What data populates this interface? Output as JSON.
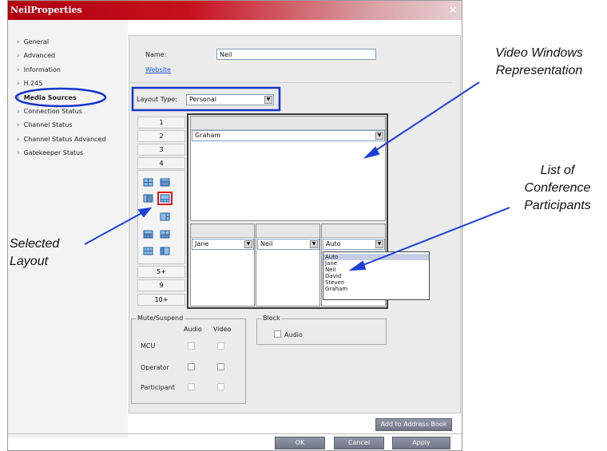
{
  "window": {
    "title": "NeilProperties",
    "close_label": "×"
  },
  "sidebar": {
    "items": [
      {
        "label": "General"
      },
      {
        "label": "Advanced"
      },
      {
        "label": "Information"
      },
      {
        "label": "H.245"
      },
      {
        "label": "Media Sources"
      },
      {
        "label": "Connection Status"
      },
      {
        "label": "Channel Status"
      },
      {
        "label": "Channel Status Advanced"
      },
      {
        "label": "Gatekeeper Status"
      }
    ],
    "active_index": 4
  },
  "header": {
    "name_label": "Name:",
    "name_value": "Neil",
    "website_link": "Website"
  },
  "layout": {
    "type_label": "Layout Type:",
    "type_value": "Personal",
    "number_buttons_top": [
      "1",
      "2",
      "3",
      "4"
    ],
    "number_buttons_bottom": [
      "5+",
      "9",
      "10+"
    ]
  },
  "video_windows": {
    "main_participant": "Graham",
    "small_participants": [
      "Jane",
      "Neil",
      "Auto"
    ],
    "dropdown_options": [
      "Auto",
      "Jane",
      "Neil",
      "David",
      "Steven",
      "Graham"
    ],
    "dropdown_selected": "Auto"
  },
  "mute_suspend": {
    "title": "Mute/Suspend",
    "col_audio": "Audio",
    "col_video": "Video",
    "rows": [
      "MCU",
      "Operator",
      "Participant"
    ]
  },
  "block": {
    "title": "Block",
    "audio_label": "Audio"
  },
  "buttons": {
    "add_to_address_book": "Add to Address Book",
    "ok": "OK",
    "cancel": "Cancel",
    "apply": "Apply"
  },
  "annotations": {
    "video_windows": "Video Windows Representation",
    "participants_list": "List of Conference Participants",
    "selected_layout": "Selected Layout"
  },
  "colors": {
    "highlight_ring": "#1634c8",
    "annotation_arrow": "#1c3fdc",
    "title_bar": "#b00010"
  }
}
